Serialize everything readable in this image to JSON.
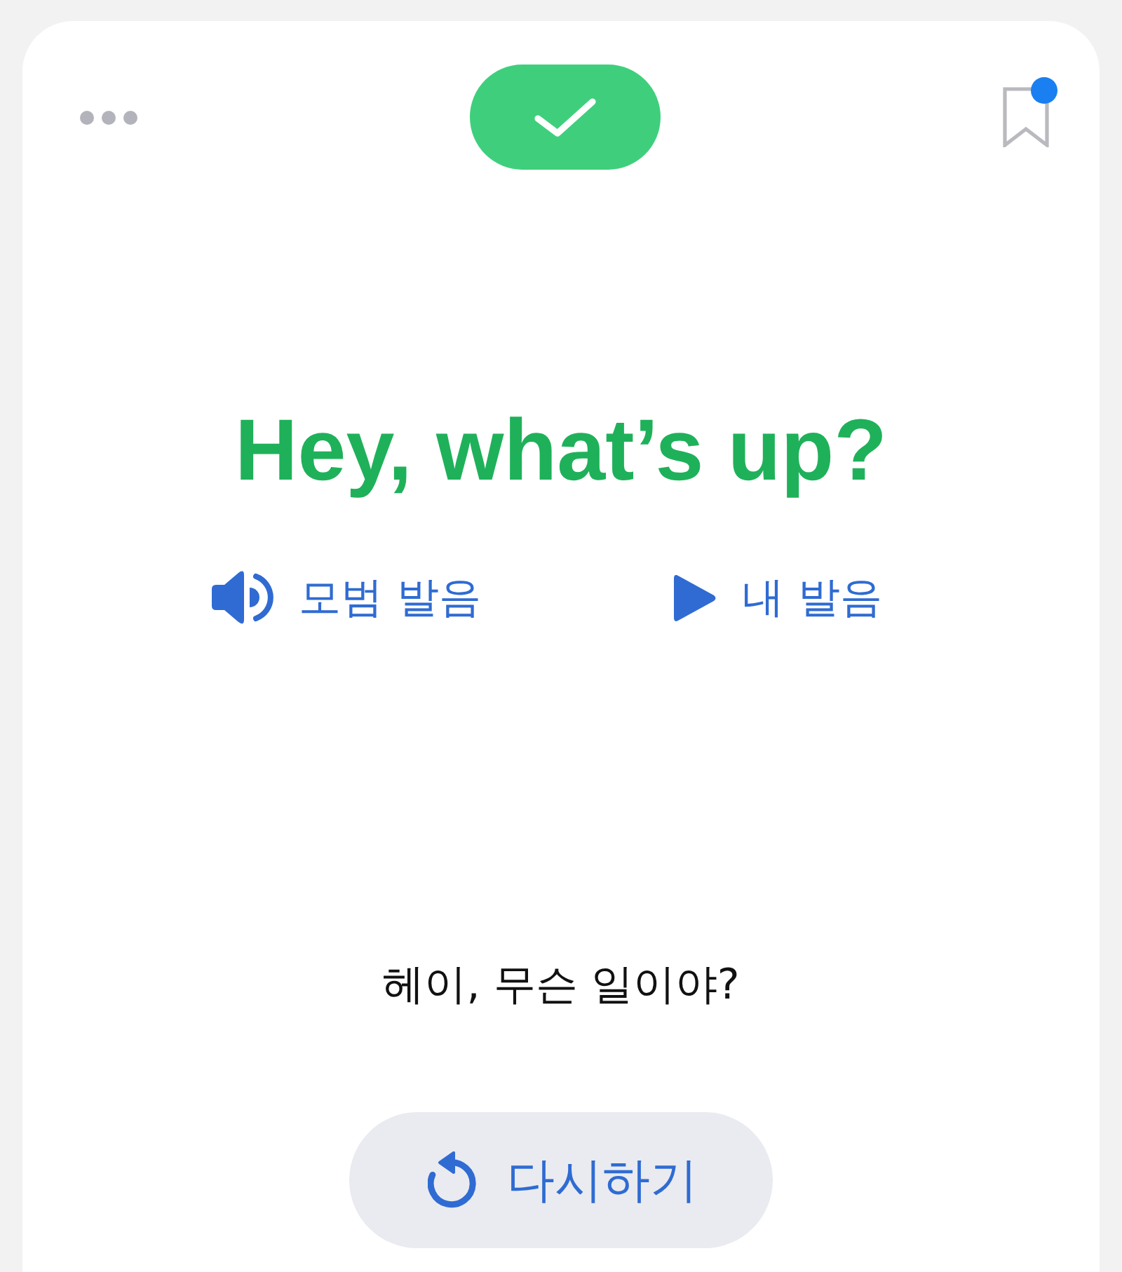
{
  "toolbar": {
    "result": {
      "correct": true
    },
    "bookmark": {
      "saved": false,
      "unread": true
    }
  },
  "phrase": {
    "text": "Hey, what’s up?"
  },
  "audio_buttons": [
    {
      "kind": "speaker",
      "label": "모범 발음"
    },
    {
      "kind": "play",
      "label": "내 발음"
    }
  ],
  "translation": {
    "text": "헤이, 무슨 일이야?"
  },
  "retry_button": {
    "label": "다시하기"
  }
}
